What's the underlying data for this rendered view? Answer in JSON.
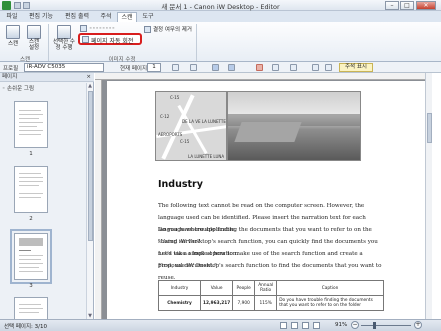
{
  "window": {
    "title": "새 문서 1 - Canon iW Desktop - Editor",
    "minimize": "–",
    "maximize": "□",
    "close": "✕"
  },
  "tabs": [
    {
      "label": "파일"
    },
    {
      "label": "편집 기능"
    },
    {
      "label": "편집 출력"
    },
    {
      "label": "주석"
    },
    {
      "label": "스캔"
    },
    {
      "label": "도구"
    }
  ],
  "ribbon": {
    "scan_label": "스캔",
    "scan_settings_label": "스캔\n설정",
    "group_scan": "스캔",
    "auto_correct_label": "선택한 수\n정 수행",
    "auto_rotate_label": "페이지 자동 회전",
    "deskew_label": "결정 여무의 제거",
    "group_image_correction": "이미지 수정",
    "extra_item_label": "◦◦◦◦◦◦◦◦"
  },
  "toolbar": {
    "profile_label": "프로필",
    "profile_value": "iR-ADV C5035",
    "page_label": "현재 페이지",
    "page_value": "1",
    "annotation_button": "주석 표시"
  },
  "left_pane": {
    "title": "페이지",
    "close": "×",
    "thumb_group_label": "◦ 손쉬운 그림",
    "thumbnails": [
      {
        "num": "1",
        "selected": false
      },
      {
        "num": "2",
        "selected": false
      },
      {
        "num": "3",
        "selected": true
      },
      {
        "num": "4",
        "selected": false
      }
    ]
  },
  "document": {
    "map_labels": [
      "C-15",
      "C-12",
      "DE LA VE LA LUNETTE",
      "AEROPORTS",
      "C-15",
      "LA LUNETTE LUNA"
    ],
    "heading": "Industry",
    "paragraphs": [
      "The following text cannot be read on the computer screen. However, the language used can be identified. Please insert the narration text for each language where applicable.",
      "Do you have trouble finding the documents that you want to refer to on the shared server?",
      "\"Using iW Desktop's search function, you can quickly find the documents you need via a simple operation.",
      "Let's take a look at how to make use of the search function and create a proposal document.\"",
      "First, use iW Desktop's search function to find the documents that you want to reuse."
    ],
    "table": {
      "headers": [
        "Industry",
        "Value",
        "People",
        "Annual Ratio",
        "Caption"
      ],
      "rows": [
        [
          "Chemistry",
          "12,963,217",
          "7,900",
          "115%",
          "Do you have trouble finding the documents that you want to refer to on the folder"
        ]
      ]
    }
  },
  "statusbar": {
    "page_info": "선택 페이지: 3/10",
    "zoom": "91%",
    "zoom_minus": "−",
    "zoom_plus": "+",
    "zoom_level": 0.3
  }
}
